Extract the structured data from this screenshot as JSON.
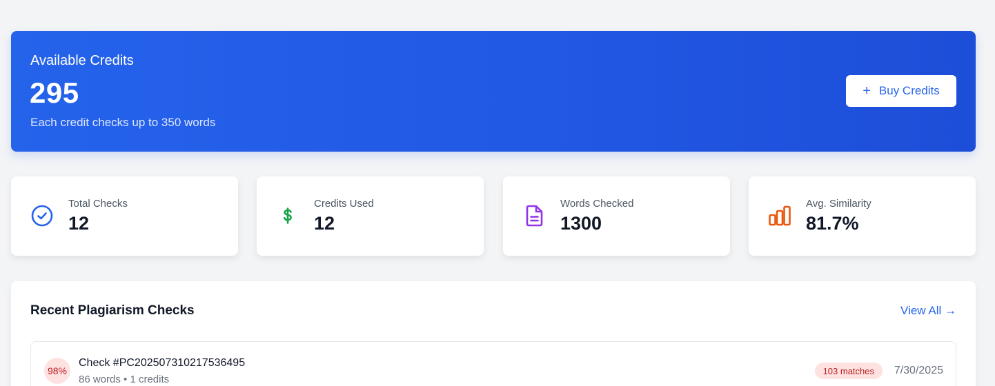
{
  "credits": {
    "label": "Available Credits",
    "value": "295",
    "description": "Each credit checks up to 350 words",
    "buy_icon": "+",
    "buy_label": "Buy Credits"
  },
  "stats": [
    {
      "label": "Total Checks",
      "value": "12",
      "icon": "check-circle-icon",
      "color": "#2563eb"
    },
    {
      "label": "Credits Used",
      "value": "12",
      "icon": "dollar-icon",
      "color": "#16a34a"
    },
    {
      "label": "Words Checked",
      "value": "1300",
      "icon": "document-icon",
      "color": "#9333ea"
    },
    {
      "label": "Avg. Similarity",
      "value": "81.7%",
      "icon": "bar-chart-icon",
      "color": "#ea580c"
    }
  ],
  "recent": {
    "title": "Recent Plagiarism Checks",
    "view_all": "View All →",
    "checks": [
      {
        "similarity": "98%",
        "id": "Check #PC202507310217536495",
        "meta": "86 words • 1 credits",
        "matches": "103 matches",
        "date": "7/30/2025"
      }
    ]
  }
}
